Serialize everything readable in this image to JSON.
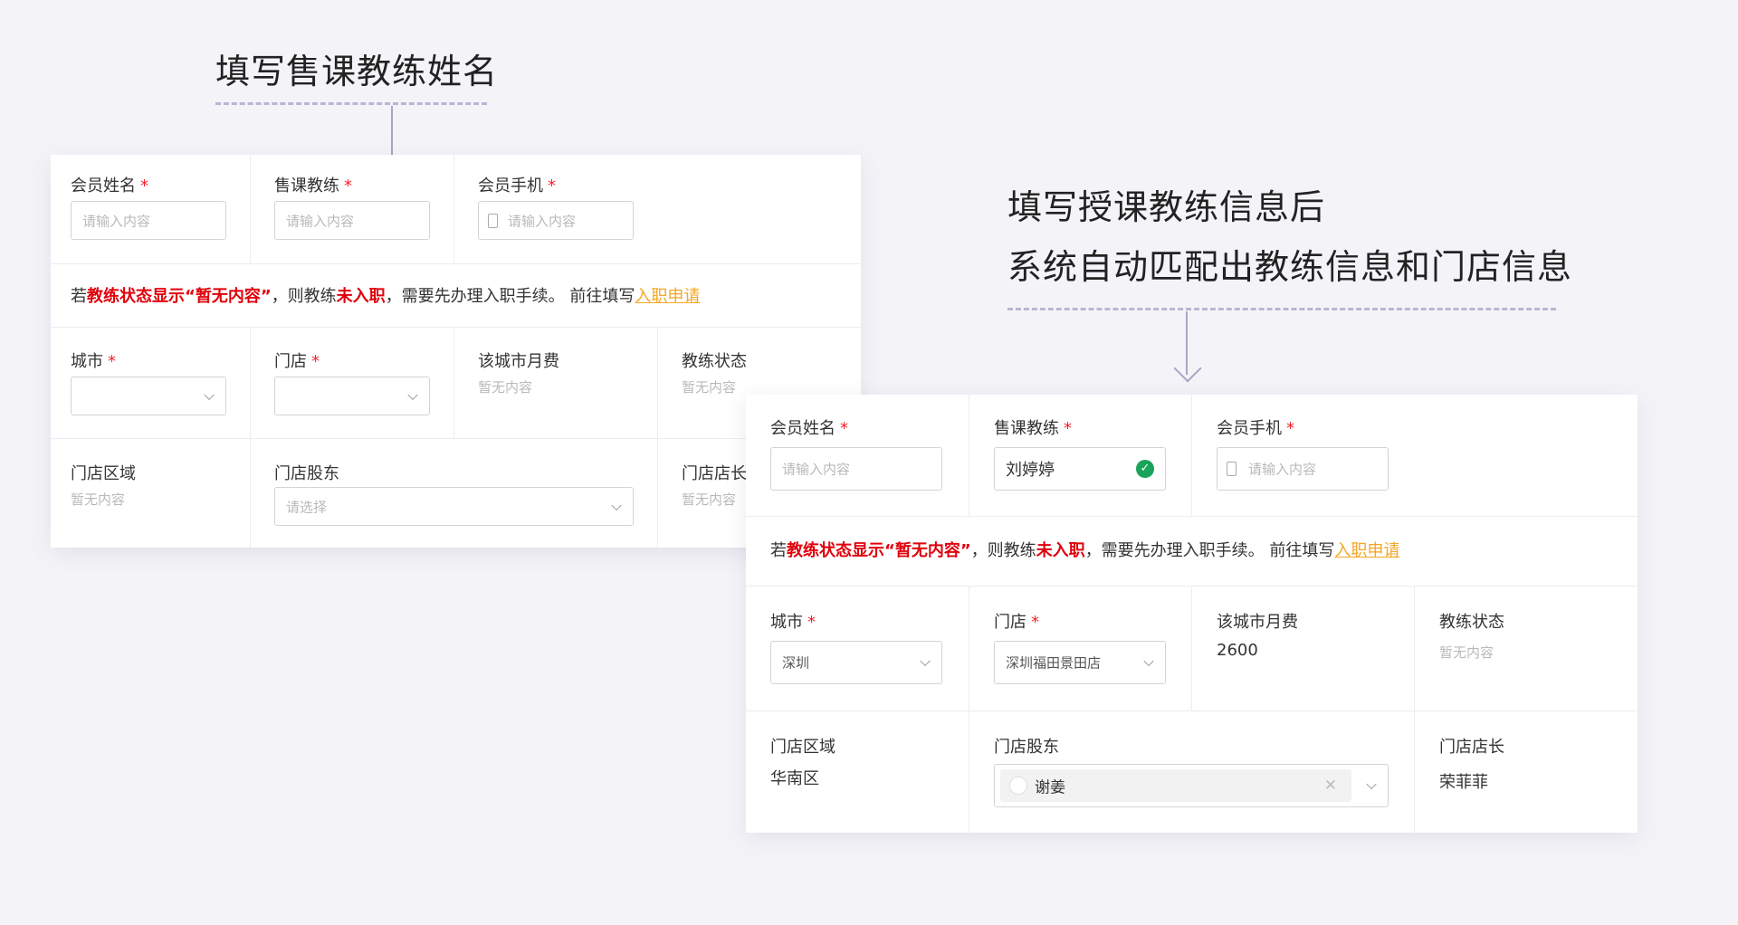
{
  "annotations": {
    "left": "填写售课教练姓名",
    "right_line1": "填写授课教练信息后",
    "right_line2": "系统自动匹配出教练信息和门店信息"
  },
  "common": {
    "required_mark": "*",
    "placeholder": "请输入内容",
    "select_placeholder": "请选择",
    "empty_value": "暂无内容"
  },
  "labels": {
    "member_name": "会员姓名",
    "sales_coach": "售课教练",
    "member_phone": "会员手机",
    "city": "城市",
    "store": "门店",
    "city_fee": "该城市月费",
    "coach_status": "教练状态",
    "store_region": "门店区域",
    "store_shareholder": "门店股东",
    "store_manager": "门店店长"
  },
  "notice": {
    "prefix": "若",
    "red1": "教练状态显示“暂无内容”",
    "mid1": "，则教练",
    "red2": "未入职",
    "mid2": "，需要先办理入职手续。 前往填写",
    "link": "入职申请"
  },
  "filled": {
    "sales_coach": "刘婷婷",
    "city": "深圳",
    "store": "深圳福田景田店",
    "city_fee": "2600",
    "store_region": "华南区",
    "shareholder": "谢姜",
    "manager": "荣菲菲"
  },
  "colors": {
    "required": "#f5222d",
    "warning_text": "#e0000b",
    "link": "#f5a623",
    "success": "#1aa35a"
  }
}
